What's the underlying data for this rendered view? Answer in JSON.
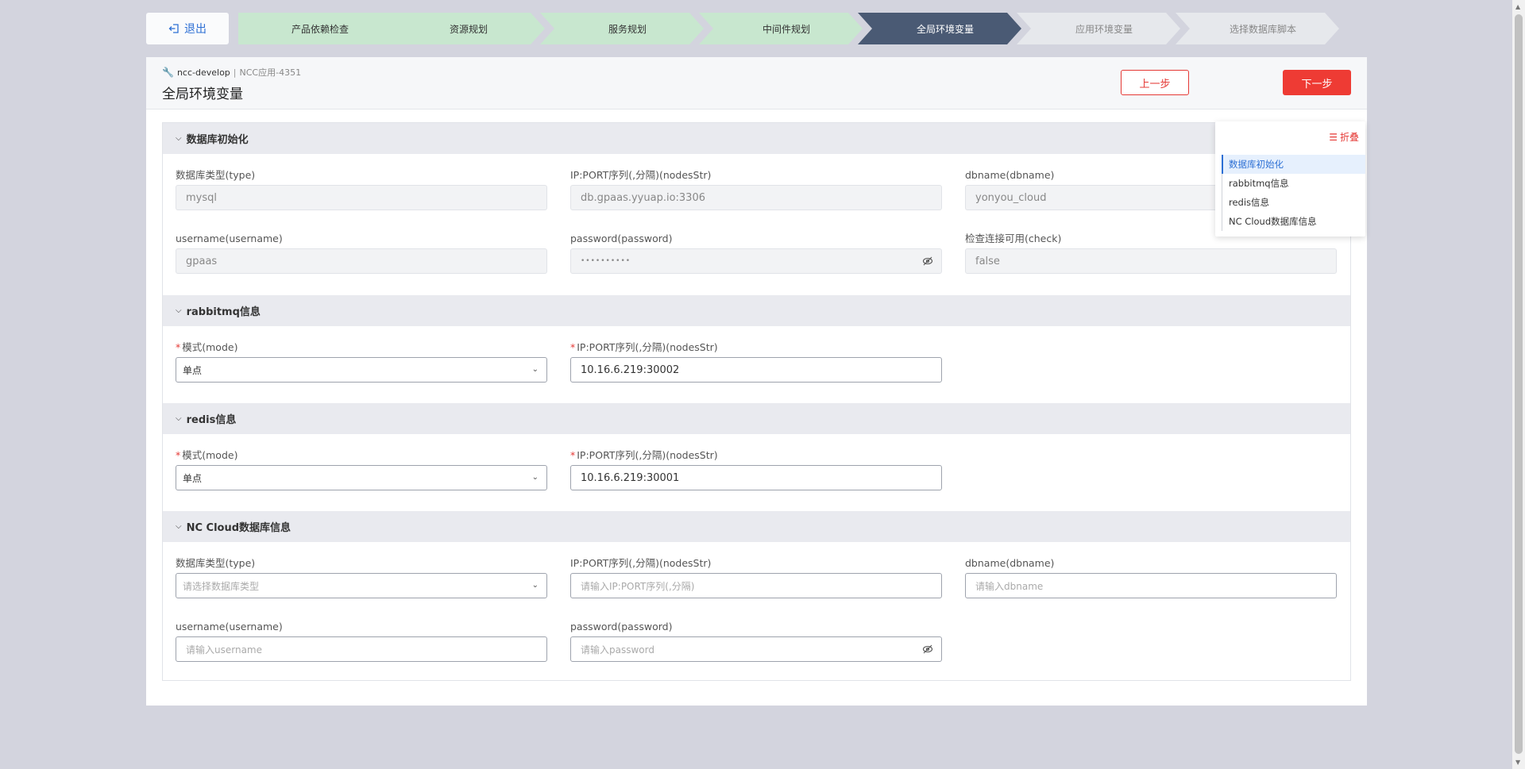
{
  "header": {
    "exit_label": "退出",
    "steps": [
      {
        "label": "产品依赖检查",
        "state": "done"
      },
      {
        "label": "资源规划",
        "state": "done"
      },
      {
        "label": "服务规划",
        "state": "done"
      },
      {
        "label": "中间件规划",
        "state": "done"
      },
      {
        "label": "全局环境变量",
        "state": "active"
      },
      {
        "label": "应用环境变量",
        "state": "todo"
      },
      {
        "label": "选择数据库脚本",
        "state": "todo"
      }
    ]
  },
  "panel": {
    "crumb_project": "ncc-develop",
    "crumb_sep": "|",
    "crumb_app": "NCC应用-4351",
    "title": "全局环境变量",
    "prev_label": "上一步",
    "next_label": "下一步"
  },
  "sections": {
    "db_init": {
      "title": "数据库初始化",
      "type_label": "数据库类型(type)",
      "type_value": "mysql",
      "nodes_label": "IP:PORT序列(,分隔)(nodesStr)",
      "nodes_value": "db.gpaas.yyuap.io:3306",
      "dbname_label": "dbname(dbname)",
      "dbname_value": "yonyou_cloud",
      "username_label": "username(username)",
      "username_value": "gpaas",
      "password_label": "password(password)",
      "password_value": "••••••••••",
      "check_label": "检查连接可用(check)",
      "check_value": "false"
    },
    "rabbitmq": {
      "title": "rabbitmq信息",
      "mode_label": "模式(mode)",
      "mode_value": "单点",
      "nodes_label": "IP:PORT序列(,分隔)(nodesStr)",
      "nodes_value": "10.16.6.219:30002"
    },
    "redis": {
      "title": "redis信息",
      "mode_label": "模式(mode)",
      "mode_value": "单点",
      "nodes_label": "IP:PORT序列(,分隔)(nodesStr)",
      "nodes_value": "10.16.6.219:30001"
    },
    "nccloud": {
      "title": "NC Cloud数据库信息",
      "type_label": "数据库类型(type)",
      "type_placeholder": "请选择数据库类型",
      "nodes_label": "IP:PORT序列(,分隔)(nodesStr)",
      "nodes_placeholder": "请输入IP:PORT序列(,分隔)",
      "dbname_label": "dbname(dbname)",
      "dbname_placeholder": "请输入dbname",
      "username_label": "username(username)",
      "username_placeholder": "请输入username",
      "password_label": "password(password)",
      "password_placeholder": "请输入password"
    }
  },
  "required_mark": "*",
  "outline": {
    "fold_label": "折叠",
    "items": [
      "数据库初始化",
      "rabbitmq信息",
      "redis信息",
      "NC Cloud数据库信息"
    ],
    "active_index": 0
  },
  "colors": {
    "accent_red": "#ee3b34",
    "accent_blue": "#2c6fd4",
    "step_done": "#c8e7cf",
    "step_active": "#4a5a74"
  }
}
